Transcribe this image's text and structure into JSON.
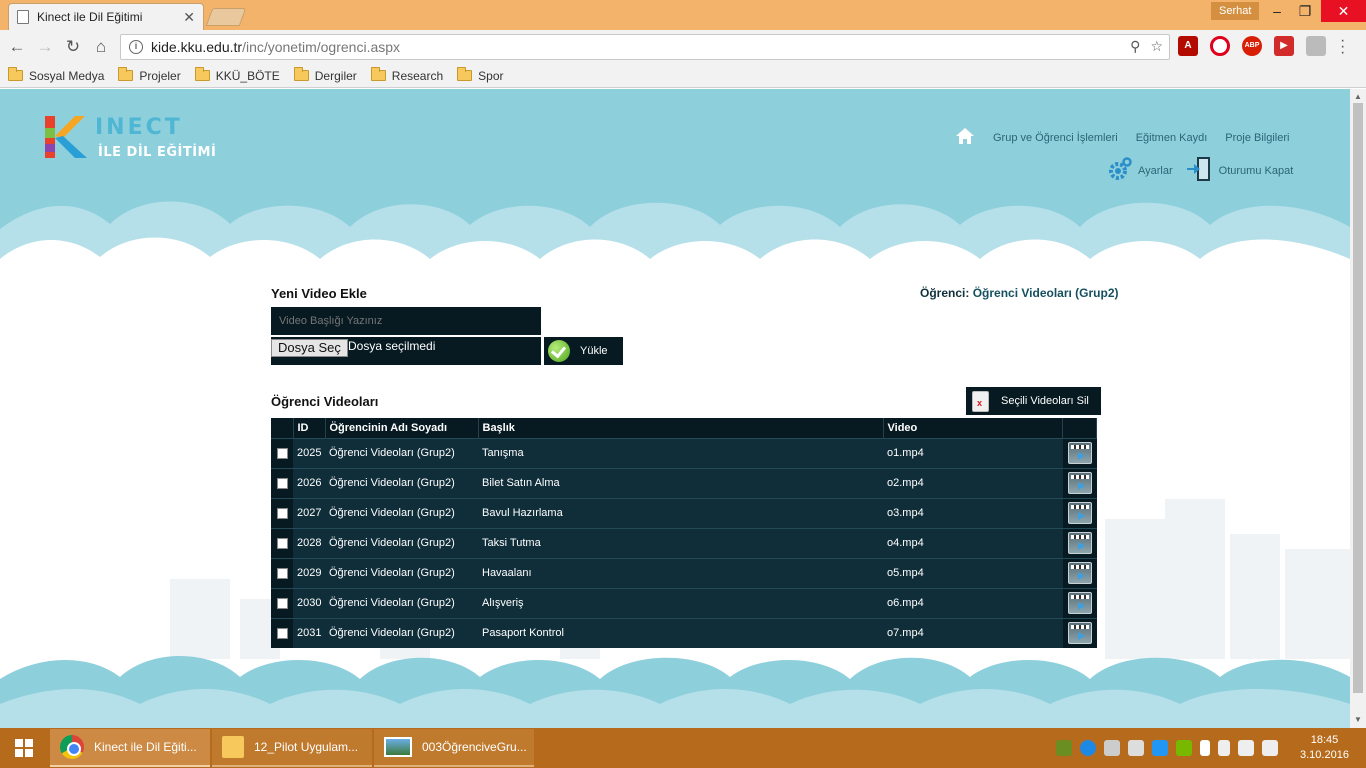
{
  "browser": {
    "tab_title": "Kinect ile Dil Eğitimi",
    "user_name": "Serhat",
    "url_host": "kide.kku.edu.tr",
    "url_path": "/inc/yonetim/ogrenci.aspx",
    "bookmarks": [
      "Sosyal Medya",
      "Projeler",
      "KKÜ_BÖTE",
      "Dergiler",
      "Research",
      "Spor"
    ]
  },
  "site": {
    "logo_text": "KINECT",
    "logo_subtitle": "İLE DİL EĞİTİMİ",
    "nav": {
      "groups": "Grup ve Öğrenci İşlemleri",
      "instructor": "Eğitmen Kaydı",
      "project": "Proje Bilgileri",
      "settings": "Ayarlar",
      "logout": "Oturumu Kapat"
    }
  },
  "upload": {
    "heading": "Yeni Video Ekle",
    "title_placeholder": "Video Başlığı Yazınız",
    "file_button": "Dosya Seç",
    "file_status": "Dosya seçilmedi",
    "upload_button": "Yükle"
  },
  "student": {
    "label": "Öğrenci:",
    "value": "Öğrenci Videoları (Grup2)"
  },
  "videos": {
    "heading": "Öğrenci Videoları",
    "delete_button": "Seçili Videoları Sil",
    "columns": [
      "ID",
      "Öğrencinin Adı Soyadı",
      "Başlık",
      "Video"
    ],
    "rows": [
      [
        "2025",
        "Öğrenci Videoları (Grup2)",
        "Tanışma",
        "o1.mp4"
      ],
      [
        "2026",
        "Öğrenci Videoları (Grup2)",
        "Bilet Satın Alma",
        "o2.mp4"
      ],
      [
        "2027",
        "Öğrenci Videoları (Grup2)",
        "Bavul Hazırlama",
        "o3.mp4"
      ],
      [
        "2028",
        "Öğrenci Videoları (Grup2)",
        "Taksi Tutma",
        "o4.mp4"
      ],
      [
        "2029",
        "Öğrenci Videoları (Grup2)",
        "Havaalanı",
        "o5.mp4"
      ],
      [
        "2030",
        "Öğrenci Videoları (Grup2)",
        "Alışveriş",
        "o6.mp4"
      ],
      [
        "2031",
        "Öğrenci Videoları (Grup2)",
        "Pasaport Kontrol",
        "o7.mp4"
      ]
    ]
  },
  "taskbar": {
    "tasks": [
      "Kinect ile Dil Eğiti...",
      "12_Pilot Uygulam...",
      "003ÖğrenciveGru..."
    ],
    "time": "18:45",
    "date": "3.10.2016"
  },
  "colors": {
    "sky": "#8ecfdc",
    "dark_panel": "#071a22",
    "row_bg": "#102e3a",
    "nav_link": "#2b6577",
    "taskbar": "#b66b1c"
  }
}
